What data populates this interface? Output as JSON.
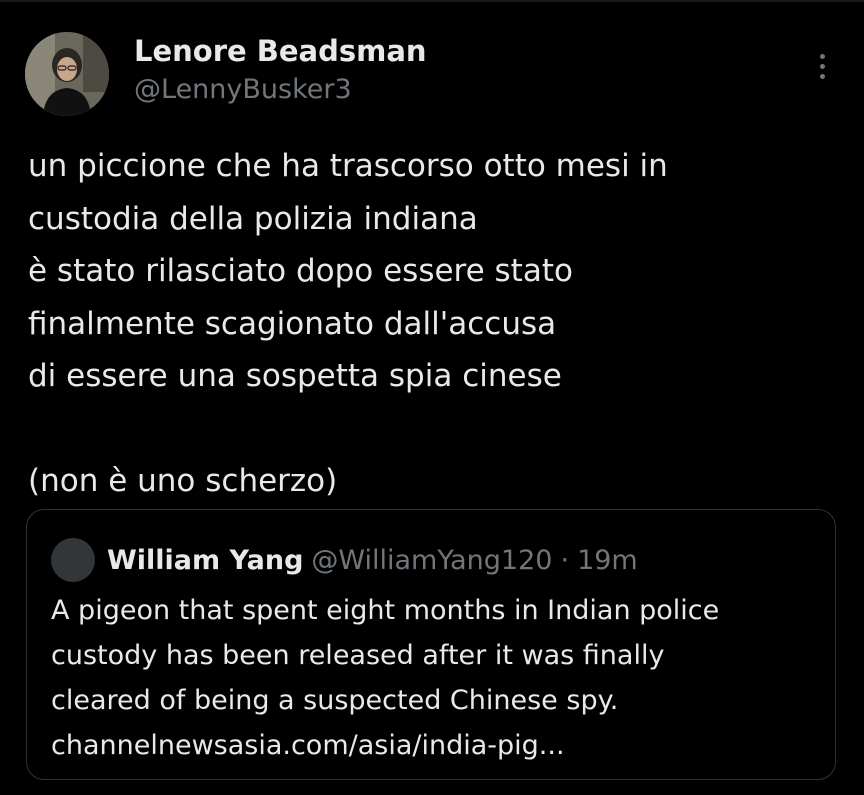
{
  "author": {
    "display_name": "Lenore Beadsman",
    "handle": "@LennyBusker3"
  },
  "tweet": {
    "lines": [
      "un piccione che ha trascorso otto mesi in",
      "custodia della polizia indiana",
      "è stato rilasciato dopo essere stato",
      "finalmente scagionato dall'accusa",
      "di essere una sospetta spia cinese",
      "",
      "(non è uno scherzo)"
    ]
  },
  "quoted_tweet": {
    "display_name": "William Yang",
    "handle": "@WilliamYang120",
    "separator": "·",
    "time": "19m",
    "lines": [
      "A pigeon that spent eight months in Indian police",
      "custody has been released after it was finally",
      "cleared of being a suspected Chinese spy.",
      "channelnewsasia.com/asia/india-pig..."
    ]
  },
  "icons": {
    "more": "more-vertical-icon"
  },
  "colors": {
    "background": "#000000",
    "primary_text": "#e7e9ea",
    "secondary_text": "#71767b",
    "border": "#2f3336"
  }
}
